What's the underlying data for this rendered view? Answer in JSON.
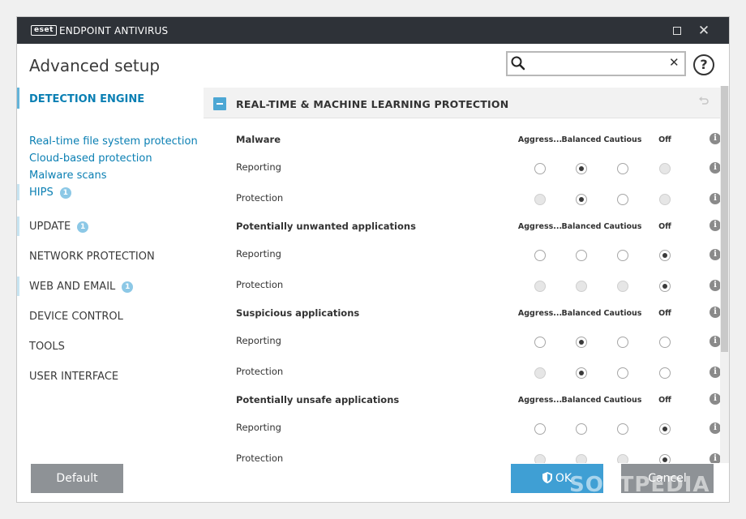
{
  "titlebar": {
    "logo": "eset",
    "title": "ENDPOINT ANTIVIRUS"
  },
  "page_title": "Advanced setup",
  "search": {
    "value": "",
    "placeholder": ""
  },
  "sidebar": {
    "detection_engine": "DETECTION ENGINE",
    "subitems": [
      "Real-time file system protection",
      "Cloud-based protection",
      "Malware scans",
      "HIPS"
    ],
    "hips_badge": "1",
    "update": "UPDATE",
    "update_badge": "1",
    "network": "NETWORK PROTECTION",
    "web_email": "WEB AND EMAIL",
    "web_email_badge": "1",
    "device": "DEVICE CONTROL",
    "tools": "TOOLS",
    "ui": "USER INTERFACE"
  },
  "section": {
    "title": "REAL-TIME & MACHINE LEARNING PROTECTION"
  },
  "columns": [
    "Aggress...",
    "Balanced",
    "Cautious",
    "Off"
  ],
  "row_labels": {
    "reporting": "Reporting",
    "protection": "Protection"
  },
  "groups": [
    {
      "title": "Malware",
      "reporting_selected": 1,
      "protection_selected": 1
    },
    {
      "title": "Potentially unwanted applications",
      "reporting_selected": 3,
      "protection_selected": 3
    },
    {
      "title": "Suspicious applications",
      "reporting_selected": 1,
      "protection_selected": 1
    },
    {
      "title": "Potentially unsafe applications",
      "reporting_selected": 3,
      "protection_selected": 3
    }
  ],
  "footer": {
    "default": "Default",
    "ok": "OK",
    "cancel": "Cancel"
  },
  "watermark": "SOFTPEDIA",
  "colors": {
    "accent": "#0a7fb3",
    "titlebar": "#2e3238",
    "ok_button": "#3f9fd4"
  }
}
